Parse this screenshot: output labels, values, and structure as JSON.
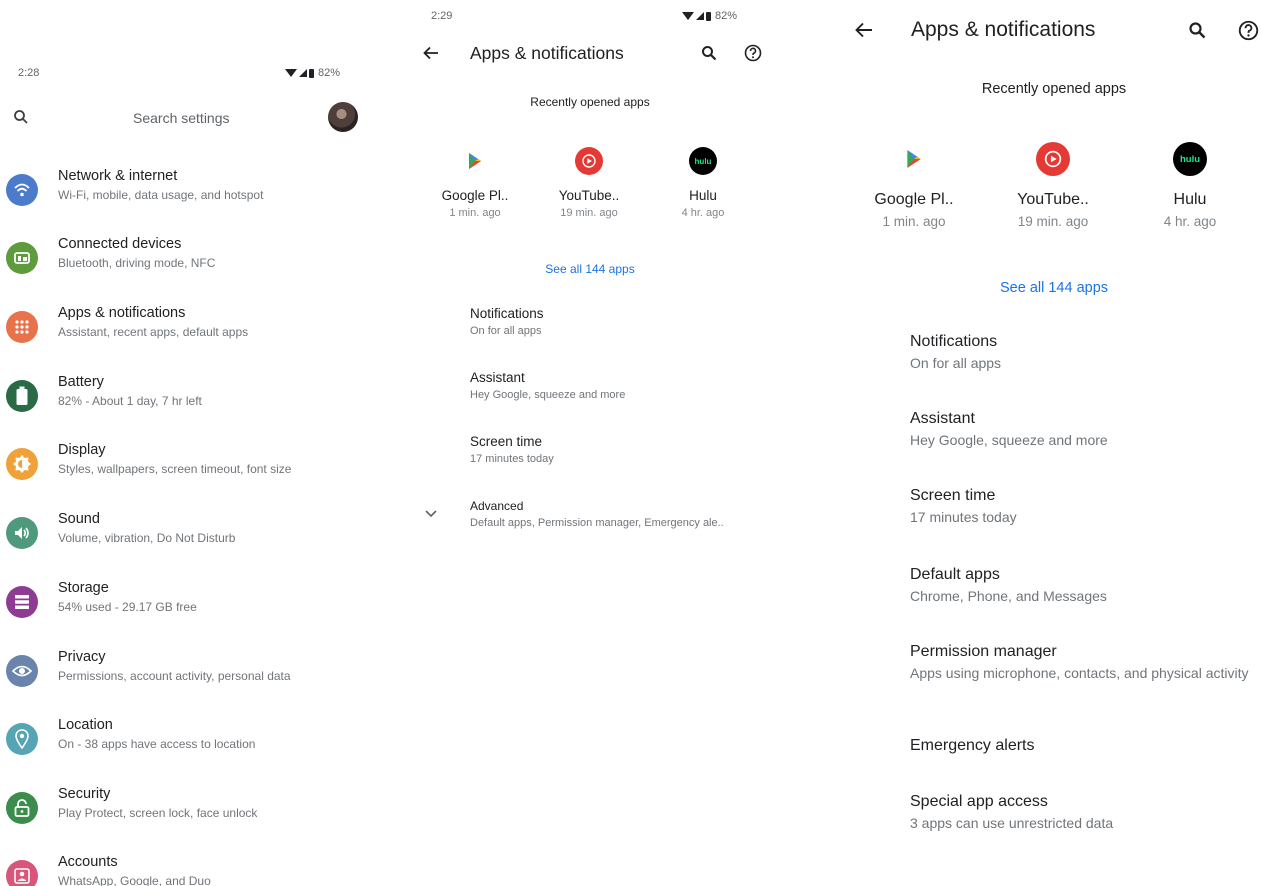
{
  "colors": {
    "network": "#4d7bcc",
    "connected": "#5d9b3c",
    "apps": "#e8734a",
    "battery": "#2a6a44",
    "display": "#f0a23a",
    "sound": "#4f9a7d",
    "storage": "#8e3b93",
    "privacy": "#6a84ac",
    "location": "#55a5b4",
    "security": "#3c8c4d",
    "accounts": "#d9557a",
    "link": "#1a73e8"
  },
  "panel1": {
    "status": {
      "time": "2:28",
      "battery": "82%"
    },
    "search": {
      "placeholder": "Search settings"
    },
    "items": [
      {
        "title": "Network & internet",
        "subtitle": "Wi-Fi, mobile, data usage, and hotspot",
        "icon": "wifi-icon"
      },
      {
        "title": "Connected devices",
        "subtitle": "Bluetooth, driving mode, NFC",
        "icon": "devices-icon"
      },
      {
        "title": "Apps & notifications",
        "subtitle": "Assistant, recent apps, default apps",
        "icon": "apps-grid-icon"
      },
      {
        "title": "Battery",
        "subtitle": "82% - About 1 day, 7 hr left",
        "icon": "battery-icon"
      },
      {
        "title": "Display",
        "subtitle": "Styles, wallpapers, screen timeout, font size",
        "icon": "brightness-icon"
      },
      {
        "title": "Sound",
        "subtitle": "Volume, vibration, Do Not Disturb",
        "icon": "volume-icon"
      },
      {
        "title": "Storage",
        "subtitle": "54% used - 29.17 GB free",
        "icon": "storage-icon"
      },
      {
        "title": "Privacy",
        "subtitle": "Permissions, account activity, personal data",
        "icon": "privacy-eye-icon"
      },
      {
        "title": "Location",
        "subtitle": "On - 38 apps have access to location",
        "icon": "location-pin-icon"
      },
      {
        "title": "Security",
        "subtitle": "Play Protect, screen lock, face unlock",
        "icon": "lock-icon"
      },
      {
        "title": "Accounts",
        "subtitle": "WhatsApp, Google, and Duo",
        "icon": "account-icon"
      }
    ]
  },
  "panel2": {
    "status": {
      "time": "2:29",
      "battery": "82%"
    },
    "title": "Apps & notifications",
    "recent_header": "Recently opened apps",
    "apps": [
      {
        "name": "Google Pl..",
        "time": "1 min. ago"
      },
      {
        "name": "YouTube..",
        "time": "19 min. ago"
      },
      {
        "name": "Hulu",
        "time": "4 hr. ago",
        "logo": "hulu"
      }
    ],
    "see_all": "See all 144 apps",
    "prefs": [
      {
        "title": "Notifications",
        "subtitle": "On for all apps"
      },
      {
        "title": "Assistant",
        "subtitle": "Hey Google, squeeze and more"
      },
      {
        "title": "Screen time",
        "subtitle": "17 minutes today"
      },
      {
        "title": "Advanced",
        "subtitle": "Default apps, Permission manager, Emergency ale.."
      }
    ]
  },
  "panel3": {
    "title": "Apps & notifications",
    "recent_header": "Recently opened apps",
    "apps": [
      {
        "name": "Google Pl..",
        "time": "1 min. ago"
      },
      {
        "name": "YouTube..",
        "time": "19 min. ago"
      },
      {
        "name": "Hulu",
        "time": "4 hr. ago",
        "logo": "hulu"
      }
    ],
    "see_all": "See all 144 apps",
    "prefs": [
      {
        "title": "Notifications",
        "subtitle": "On for all apps"
      },
      {
        "title": "Assistant",
        "subtitle": "Hey Google, squeeze and more"
      },
      {
        "title": "Screen time",
        "subtitle": "17 minutes today"
      },
      {
        "title": "Default apps",
        "subtitle": "Chrome, Phone, and Messages"
      },
      {
        "title": "Permission manager",
        "subtitle": "Apps using microphone, contacts, and physical activity"
      },
      {
        "title": "Emergency alerts",
        "subtitle": ""
      },
      {
        "title": "Special app access",
        "subtitle": "3 apps can use unrestricted data"
      }
    ]
  }
}
